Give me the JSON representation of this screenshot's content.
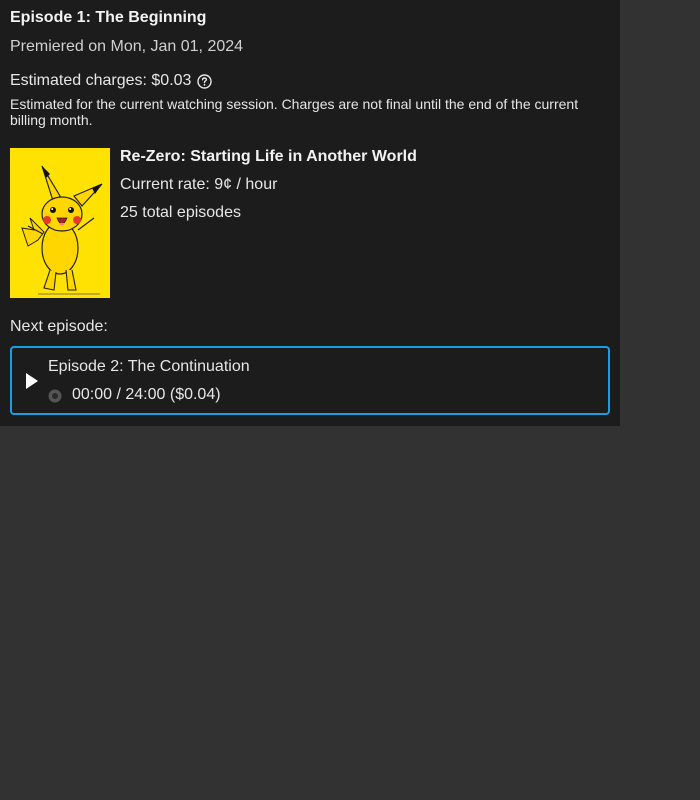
{
  "episode": {
    "title": "Episode 1: The Beginning",
    "premiered": "Premiered on Mon, Jan 01, 2024"
  },
  "charges": {
    "label": "Estimated charges: $0.03",
    "help_icon": "question-circle-icon",
    "note": "Estimated for the current watching session. Charges are not final until the end of the current billing month."
  },
  "show": {
    "title": "Re-Zero: Starting Life in Another World",
    "rate": "Current rate: 9¢ / hour",
    "episodes": "25 total episodes",
    "poster_background": "#ffe102"
  },
  "next": {
    "label": "Next episode:",
    "title": "Episode 2: The Continuation",
    "progress": "00:00 / 24:00 ($0.04)",
    "play_icon": "play-icon",
    "accent": "#1a9ee0"
  }
}
